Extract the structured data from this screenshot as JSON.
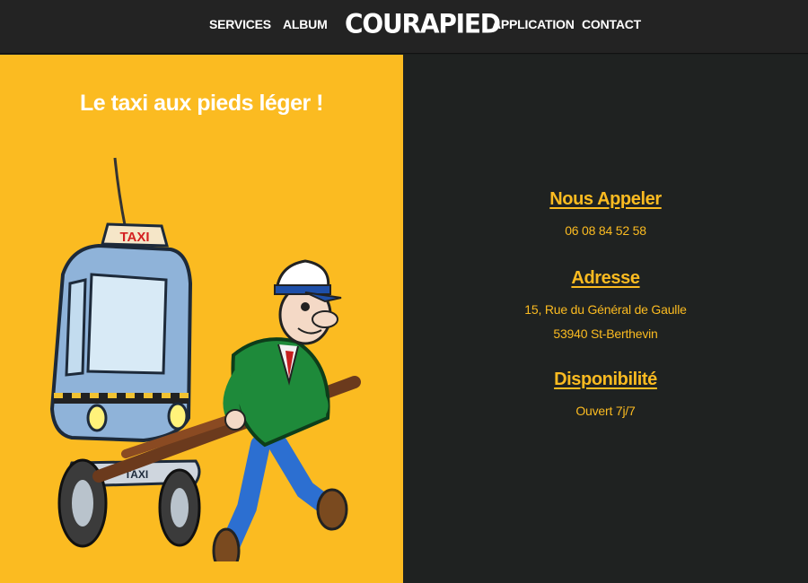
{
  "nav": {
    "services": "SERVICES",
    "album": "ALBUM",
    "logo": "COURAPIED",
    "application": "APPLICATION",
    "contact": "CONTACT"
  },
  "hero": {
    "tagline": "Le taxi aux pieds léger !",
    "taxi_sign": "TAXI",
    "bumper_label": "TAXI"
  },
  "contact": {
    "phone_heading": "Nous Appeler",
    "phone": "06 08 84 52 58",
    "address_heading": "Adresse",
    "address_line1": "15, Rue du Général de Gaulle",
    "address_line2": "53940 St-Berthevin",
    "availability_heading": "Disponibilité",
    "availability": "Ouvert 7j/7"
  },
  "colors": {
    "accent_yellow": "#fbbb21",
    "nav_background": "#232323",
    "dark_panel": "#1f2221"
  }
}
